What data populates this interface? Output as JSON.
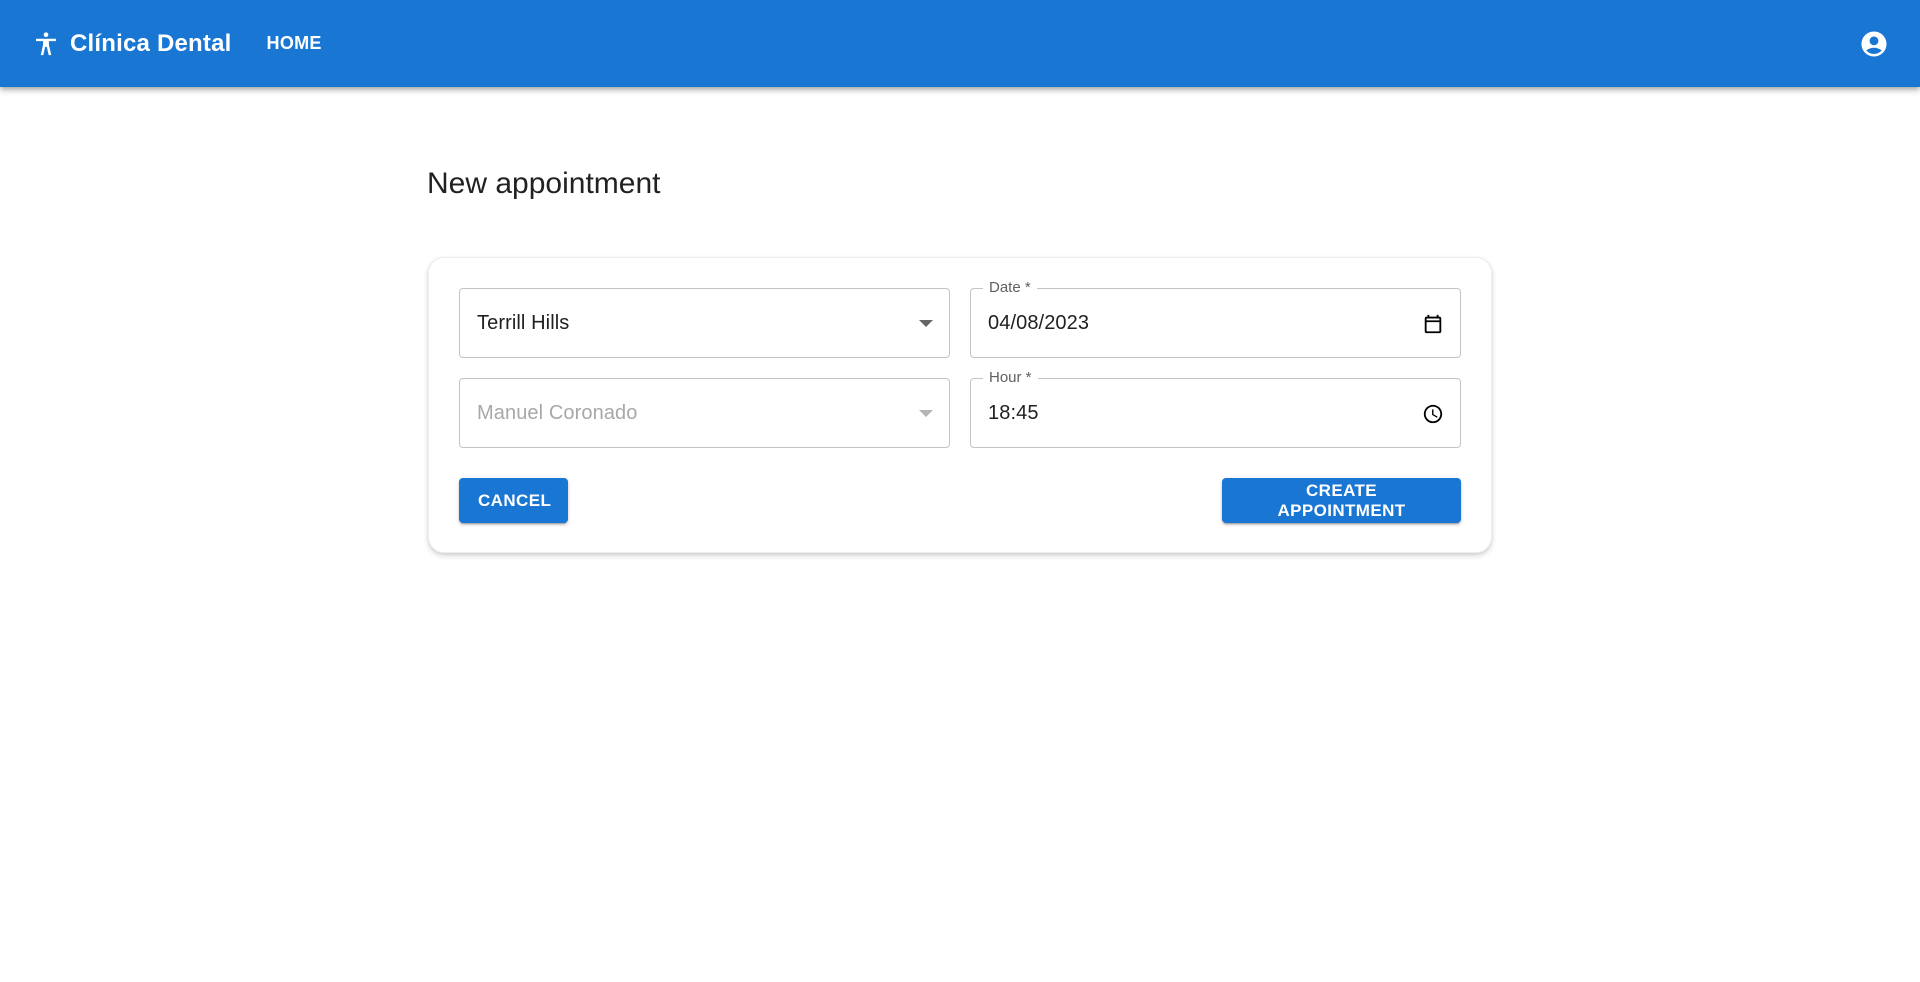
{
  "header": {
    "brand_name": "Clínica Dental",
    "brand_icon": "accessibility-icon",
    "nav_home": "HOME",
    "account_icon": "account-circle-icon",
    "background_color": "#1976d2"
  },
  "page": {
    "title": "New appointment"
  },
  "form": {
    "patient": {
      "value": "Terrill Hills"
    },
    "dentist": {
      "value": "Manuel Coronado",
      "disabled": true
    },
    "date": {
      "label": "Date *",
      "value": "04/08/2023",
      "icon": "calendar-icon"
    },
    "hour": {
      "label": "Hour *",
      "value": "18:45",
      "icon": "clock-icon"
    }
  },
  "actions": {
    "cancel_label": "CANCEL",
    "create_label": "CREATE APPOINTMENT",
    "button_color": "#1976d2"
  }
}
